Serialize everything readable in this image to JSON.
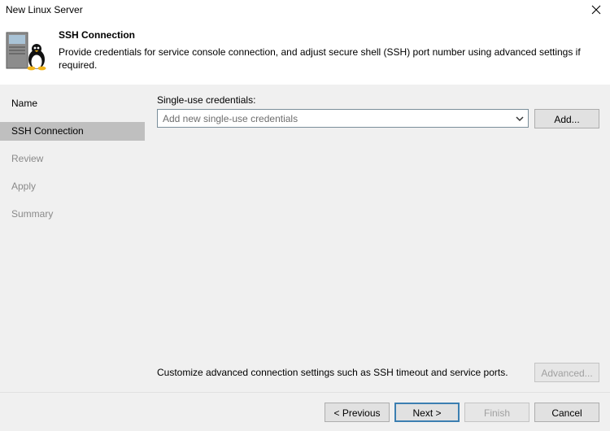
{
  "window": {
    "title": "New Linux Server"
  },
  "header": {
    "step_title": "SSH Connection",
    "step_description": "Provide credentials for service console connection, and adjust secure shell (SSH) port number using advanced settings if required."
  },
  "sidebar": {
    "items": [
      {
        "label": "Name",
        "state": "done"
      },
      {
        "label": "SSH Connection",
        "state": "active"
      },
      {
        "label": "Review",
        "state": "disabled"
      },
      {
        "label": "Apply",
        "state": "disabled"
      },
      {
        "label": "Summary",
        "state": "disabled"
      }
    ]
  },
  "main": {
    "credentials_label": "Single-use credentials:",
    "credentials_placeholder": "Add new single-use credentials",
    "add_button": "Add...",
    "advanced_text": "Customize advanced connection settings such as SSH timeout and service ports.",
    "advanced_button": "Advanced..."
  },
  "footer": {
    "previous": "< Previous",
    "next": "Next >",
    "finish": "Finish",
    "cancel": "Cancel"
  },
  "icons": {
    "close": "close-icon",
    "wizard": "linux-server-icon",
    "dropdown": "chevron-down-icon"
  },
  "colors": {
    "sidebar_active": "#bfbfbf",
    "panel_bg": "#f0f0f0",
    "primary_border": "#3c7fb1",
    "disabled_text": "#8a8a8a"
  }
}
